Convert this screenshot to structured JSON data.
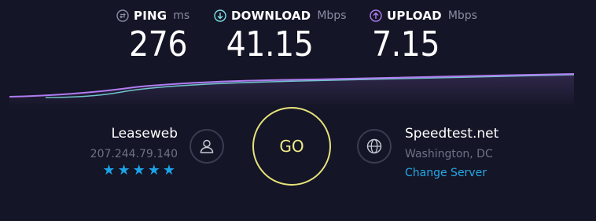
{
  "metrics": {
    "ping": {
      "label": "PING",
      "unit": "ms",
      "value": "276"
    },
    "download": {
      "label": "DOWNLOAD",
      "unit": "Mbps",
      "value": "41.15"
    },
    "upload": {
      "label": "UPLOAD",
      "unit": "Mbps",
      "value": "7.15"
    }
  },
  "isp": {
    "name": "Leaseweb",
    "ip": "207.244.79.140",
    "stars": "★★★★★",
    "rating": 5
  },
  "go_button": {
    "label": "GO"
  },
  "server": {
    "name": "Speedtest.net",
    "location": "Washington, DC",
    "change_label": "Change Server"
  },
  "colors": {
    "background": "#141526",
    "go_ring": "#e6e27a",
    "download_line": "#7fe0e6",
    "upload_line": "#b07cf0",
    "link": "#24a9e8",
    "stars": "#1ba3e8"
  },
  "icons": [
    "ping-icon",
    "download-icon",
    "upload-icon",
    "user-icon",
    "globe-icon"
  ]
}
